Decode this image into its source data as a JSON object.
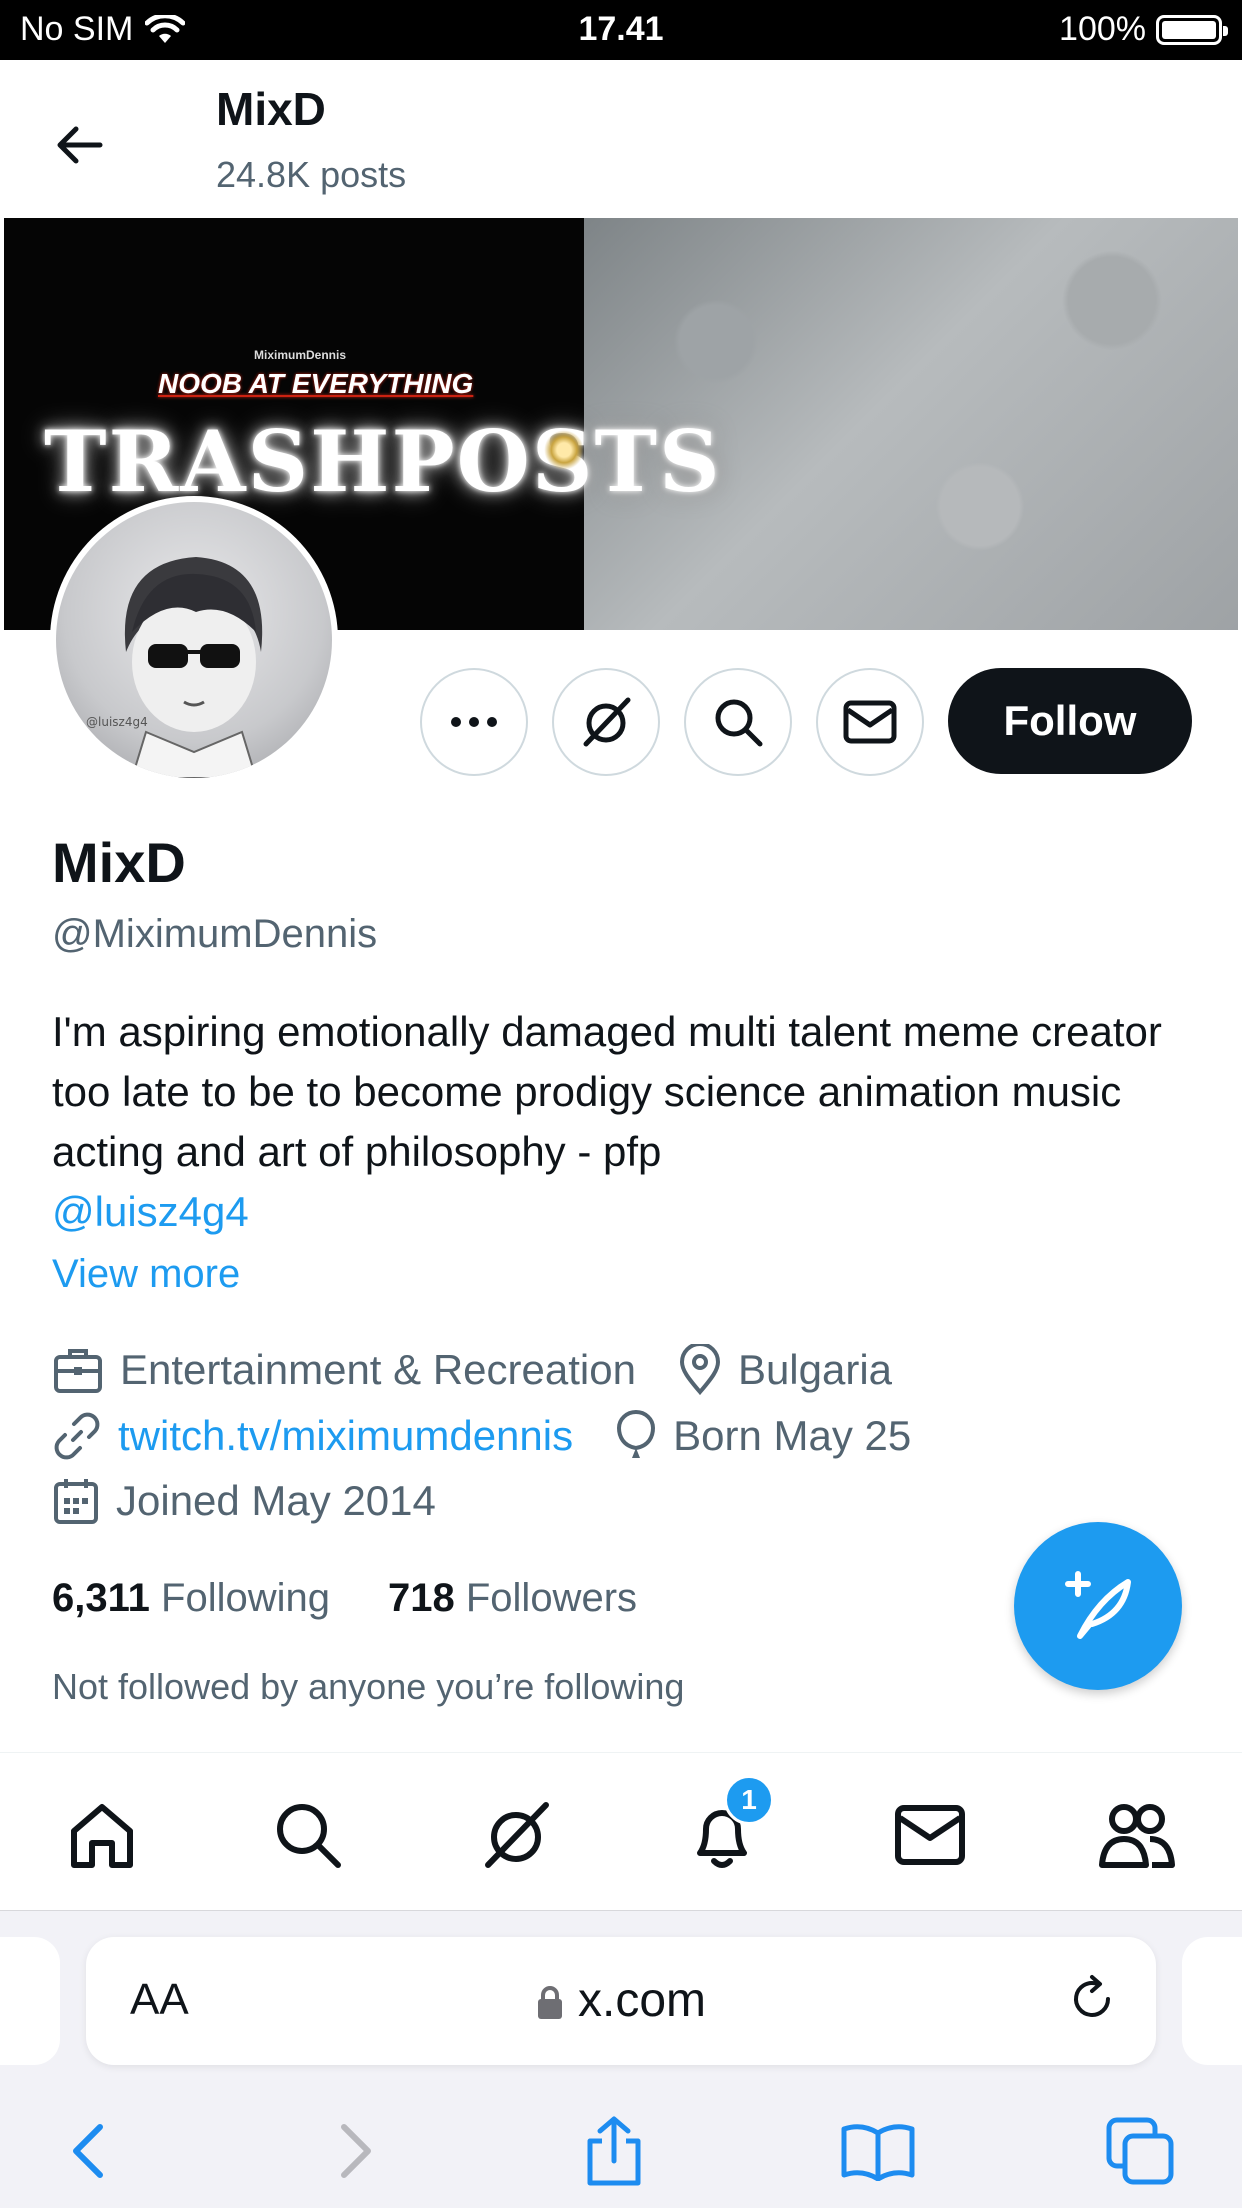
{
  "status_bar": {
    "carrier": "No SIM",
    "time": "17.41",
    "battery": "100%"
  },
  "header": {
    "title": "MixD",
    "posts": "24.8K posts"
  },
  "banner": {
    "small_text": "MiximumDennis",
    "line1": "NOOB AT EVERYTHING",
    "line2": "TRASHPOSTS"
  },
  "actions": {
    "follow_label": "Follow"
  },
  "profile": {
    "name": "MixD",
    "handle": "@MiximumDennis",
    "bio": "I'm aspiring emotionally damaged multi talent meme creator too late to be to become prodigy science animation music acting and art of philosophy - pfp",
    "bio_mention": "@luisz4g4",
    "view_more": "View more",
    "category": "Entertainment & Recreation",
    "location": "Bulgaria",
    "website": "twitch.tv/miximumdennis",
    "birthday": "Born May 25",
    "joined": "Joined May 2014",
    "following_count": "6,311",
    "following_label": "Following",
    "followers_count": "718",
    "followers_label": "Followers",
    "not_followed": "Not followed by anyone you’re following"
  },
  "nav": {
    "notification_badge": "1"
  },
  "browser": {
    "text_size": "AA",
    "url": "x.com"
  },
  "colors": {
    "accent": "#1d9bf0",
    "text": "#0f1419",
    "secondary": "#536471"
  }
}
